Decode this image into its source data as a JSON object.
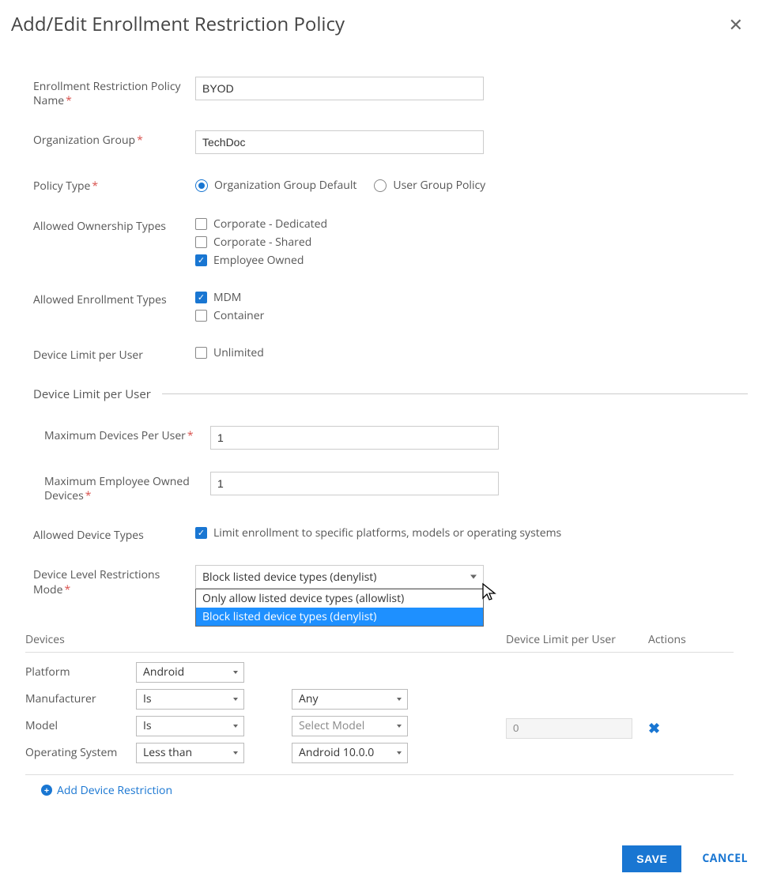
{
  "dialog": {
    "title": "Add/Edit Enrollment Restriction Policy"
  },
  "fields": {
    "policy_name": {
      "label": "Enrollment Restriction Policy Name",
      "value": "BYOD"
    },
    "org_group": {
      "label": "Organization Group",
      "value": "TechDoc"
    },
    "policy_type": {
      "label": "Policy Type",
      "options": [
        {
          "label": "Organization Group Default",
          "selected": true
        },
        {
          "label": "User Group Policy",
          "selected": false
        }
      ]
    },
    "allowed_ownership": {
      "label": "Allowed Ownership Types",
      "options": [
        {
          "label": "Corporate - Dedicated",
          "checked": false
        },
        {
          "label": "Corporate - Shared",
          "checked": false
        },
        {
          "label": "Employee Owned",
          "checked": true
        }
      ]
    },
    "allowed_enrollment": {
      "label": "Allowed Enrollment Types",
      "options": [
        {
          "label": "MDM",
          "checked": true
        },
        {
          "label": "Container",
          "checked": false
        }
      ]
    },
    "device_limit_per_user": {
      "label": "Device Limit per User",
      "option": {
        "label": "Unlimited",
        "checked": false
      }
    }
  },
  "device_limit_section": {
    "title": "Device Limit per User",
    "max_devices": {
      "label": "Maximum Devices Per User",
      "value": "1"
    },
    "max_employee_owned": {
      "label": "Maximum Employee Owned Devices",
      "value": "1"
    }
  },
  "allowed_device_types": {
    "label": "Allowed Device Types",
    "checkbox_label": "Limit enrollment to specific platforms, models or operating systems",
    "checked": true
  },
  "restrictions_mode": {
    "label": "Device Level Restrictions Mode",
    "selected": "Block listed device types (denylist)",
    "options": [
      "Only allow listed device types (allowlist)",
      "Block listed device types (denylist)"
    ]
  },
  "devices_table": {
    "headers": {
      "devices": "Devices",
      "limit": "Device Limit per User",
      "actions": "Actions"
    },
    "row": {
      "platform": {
        "label": "Platform",
        "value": "Android"
      },
      "manufacturer": {
        "label": "Manufacturer",
        "op": "Is",
        "value": "Any"
      },
      "model": {
        "label": "Model",
        "op": "Is",
        "placeholder": "Select Model"
      },
      "os": {
        "label": "Operating System",
        "op": "Less than",
        "value": "Android 10.0.0"
      },
      "limit_value": "0"
    },
    "add_link": "Add Device Restriction"
  },
  "footer": {
    "save": "SAVE",
    "cancel": "CANCEL"
  }
}
